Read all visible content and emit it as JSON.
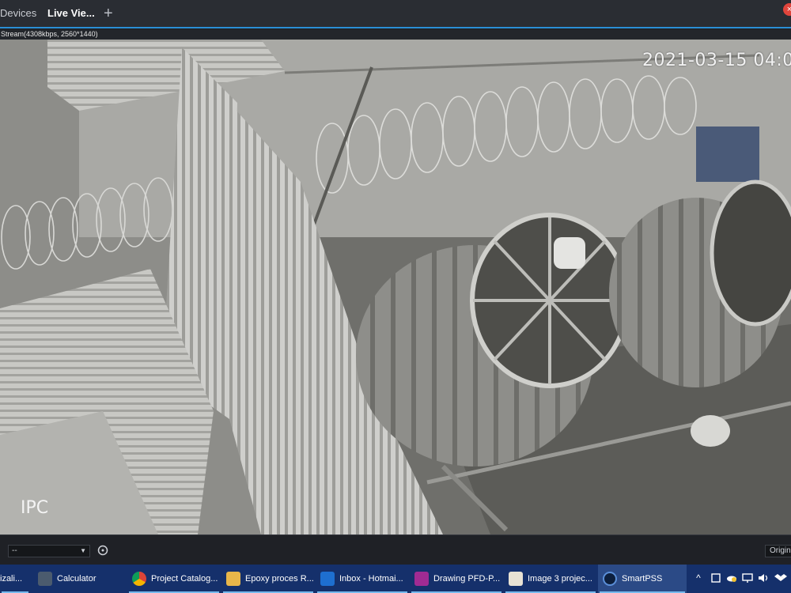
{
  "app": {
    "tabs": [
      {
        "label": "Devices"
      },
      {
        "label": "Live Vie..."
      },
      {
        "label": "+"
      }
    ],
    "close_glyph": "×",
    "stream_info": "Stream(4308kbps, 2560*1440)"
  },
  "video": {
    "osd_timestamp": "2021-03-15 04:0",
    "osd_camera_name": "IPC"
  },
  "controls": {
    "stream_select_value": "--",
    "stream_select_caret": "▼",
    "original_label": "Origina"
  },
  "taskbar": {
    "items": [
      {
        "label": "izali..."
      },
      {
        "label": "Calculator"
      },
      {
        "label": "Project Catalog..."
      },
      {
        "label": "Epoxy proces R..."
      },
      {
        "label": "Inbox - Hotmai..."
      },
      {
        "label": "Drawing PFD-P..."
      },
      {
        "label": "Image 3 projec..."
      },
      {
        "label": "SmartPSS"
      }
    ],
    "tray_chevron": "^"
  },
  "colors": {
    "accent": "#2a8fd6",
    "taskbar": "#15306b",
    "close": "#e0453c"
  }
}
